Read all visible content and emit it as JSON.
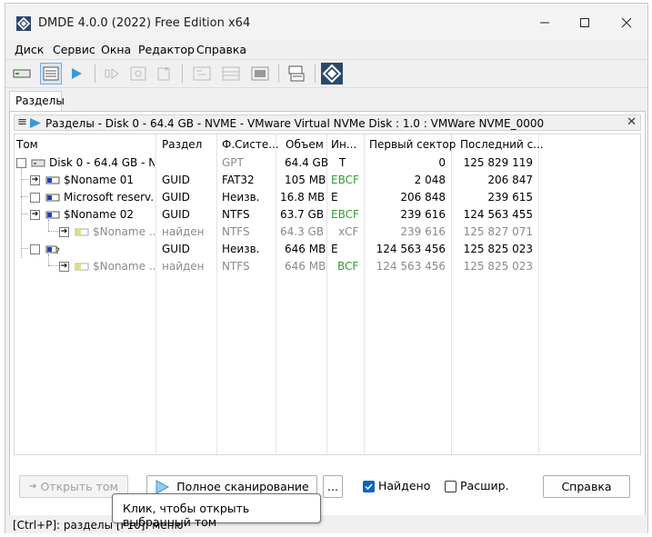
{
  "window": {
    "title": "DMDE 4.0.0 (2022) Free Edition x64",
    "minimize_icon": "minimize-icon",
    "maximize_icon": "maximize-icon",
    "close_icon": "close-icon"
  },
  "menu": [
    "Диск",
    "Сервис",
    "Окна",
    "Редактор",
    "Справка"
  ],
  "tab": {
    "label": "Разделы"
  },
  "panel": {
    "header": "Разделы - Disk 0 - 64.4 GB - NVME - VMware Virtual NVMe Disk : 1.0 : VMWare NVME_0000"
  },
  "table": {
    "columns": [
      "Том",
      "Раздел",
      "Ф.Систе...",
      "Объем",
      "Ин...",
      "Первый сектор",
      "Последний с..."
    ],
    "rows": [
      {
        "name": "Disk 0 - 64.4 GB - N...",
        "part": "",
        "fs": "GPT",
        "size": "64.4 GB",
        "ind": "T",
        "first": "0",
        "last": "125 829 119",
        "style": "normal",
        "fs_grey": true
      },
      {
        "name": "$Noname 01",
        "part": "GUID",
        "fs": "FAT32",
        "size": "105 MB",
        "ind": "EBCF",
        "first": "2 048",
        "last": "206 847",
        "style": "normal",
        "ind_green": true
      },
      {
        "name": "Microsoft reserv...",
        "part": "GUID",
        "fs": "Неизв.",
        "size": "16.8 MB",
        "ind": "E",
        "first": "206 848",
        "last": "239 615",
        "style": "normal"
      },
      {
        "name": "$Noname 02",
        "part": "GUID",
        "fs": "NTFS",
        "size": "63.7 GB",
        "ind": "EBCF",
        "first": "239 616",
        "last": "124 563 455",
        "style": "normal",
        "ind_green": true
      },
      {
        "name": "$Noname ...",
        "part": "найден",
        "fs": "NTFS",
        "size": "64.3 GB",
        "ind": "xCF",
        "first": "239 616",
        "last": "125 827 071",
        "style": "grey"
      },
      {
        "name": "",
        "part": "GUID",
        "fs": "Неизв.",
        "size": "646 MB",
        "ind": "E",
        "first": "124 563 456",
        "last": "125 825 023",
        "style": "normal"
      },
      {
        "name": "$Noname ...",
        "part": "найден",
        "fs": "NTFS",
        "size": "646 MB",
        "ind": "BCF",
        "first": "124 563 456",
        "last": "125 825 023",
        "style": "grey",
        "ind_green": true
      }
    ]
  },
  "buttons": {
    "open_volume": "Открыть том",
    "full_scan": "Полное сканирование",
    "more": "...",
    "found_label": "Найдено",
    "extended_label": "Расшир.",
    "help": "Справка"
  },
  "checkboxes": {
    "found_checked": true,
    "extended_checked": false
  },
  "tooltip": "Клик, чтобы открыть выбранный том",
  "status": "[Ctrl+P]: разделы  [F10]: меню",
  "colors": {
    "accent": "#0a64c8",
    "play": "#3a9ad9",
    "green": "#2e9e2e",
    "grey": "#8a8a8a"
  }
}
